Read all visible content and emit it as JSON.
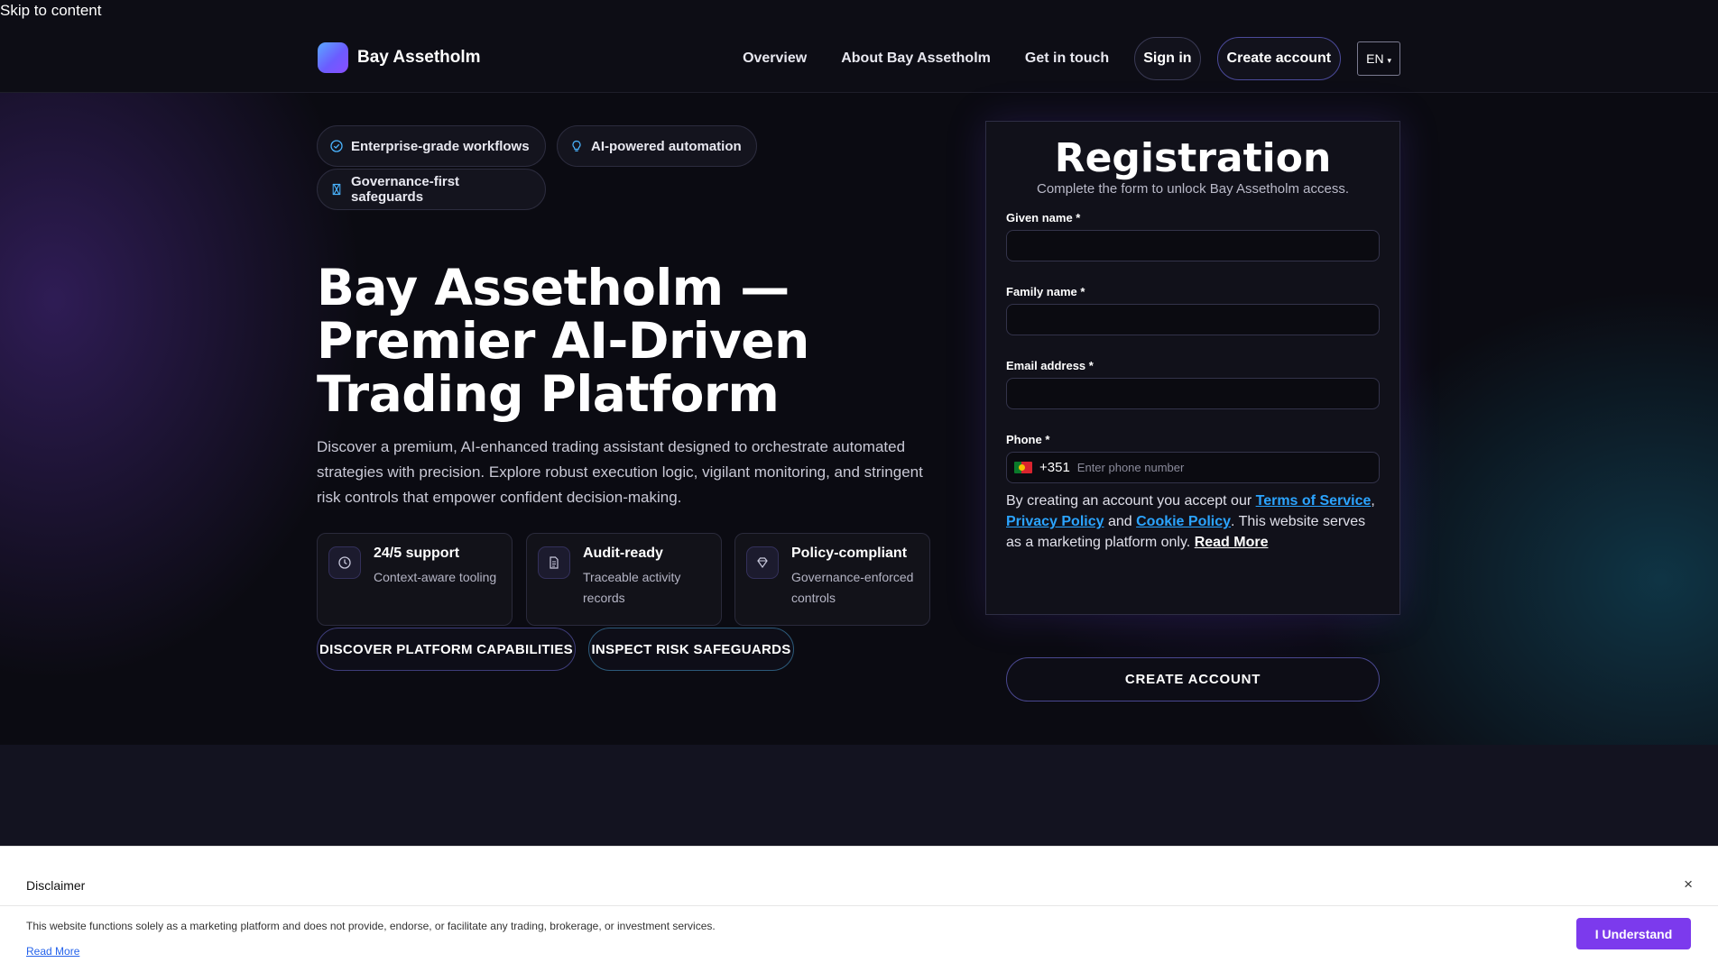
{
  "skip_link": "Skip to content",
  "brand": {
    "name": "Bay Assetholm"
  },
  "nav": {
    "links": [
      "Overview",
      "About Bay Assetholm",
      "Get in touch"
    ],
    "sign_in": "Sign in",
    "create_account": "Create account",
    "language": "EN"
  },
  "hero": {
    "chips": [
      "Enterprise-grade workflows",
      "AI-powered automation",
      "Governance-first safeguards"
    ],
    "title": "Bay Assetholm — Premier AI-Driven Trading Platform",
    "description": "Discover a premium, AI-enhanced trading assistant designed to orchestrate automated strategies with precision. Explore robust execution logic, vigilant monitoring, and stringent risk controls that empower confident decision-making.",
    "features": [
      {
        "icon": "clock-icon",
        "title": "24/5 support",
        "subtitle": "Context-aware tooling"
      },
      {
        "icon": "document-icon",
        "title": "Audit-ready",
        "subtitle": "Traceable activity records"
      },
      {
        "icon": "diamond-icon",
        "title": "Policy-compliant",
        "subtitle": "Governance-enforced controls"
      }
    ],
    "cta_primary": "DISCOVER PLATFORM CAPABILITIES",
    "cta_secondary": "INSPECT RISK SAFEGUARDS"
  },
  "registration": {
    "title": "Registration",
    "subtitle": "Complete the form to unlock Bay Assetholm access.",
    "given_name_label": "Given name *",
    "family_name_label": "Family name *",
    "email_label": "Email address *",
    "phone_label": "Phone *",
    "dial_code": "+351",
    "phone_placeholder": "Enter phone number",
    "terms": {
      "prefix": "By creating an account you accept our ",
      "terms_link": "Terms of Service",
      "comma": ", ",
      "privacy_link": "Privacy Policy",
      "and": " and ",
      "cookie_link": "Cookie Policy",
      "suffix": ". This website serves as a marketing platform only. ",
      "read_more": "Read More"
    },
    "submit": "CREATE ACCOUNT"
  },
  "disclaimer": {
    "title": "Disclaimer",
    "close": "×",
    "body": "This website functions solely as a marketing platform and does not provide, endorse, or facilitate any trading, brokerage, or investment services.",
    "read_more": "Read More",
    "accept": "I Understand"
  },
  "colors": {
    "background": "#0b0b12",
    "accent_link": "#2ba4ff",
    "accept_button": "#7c3aed"
  }
}
